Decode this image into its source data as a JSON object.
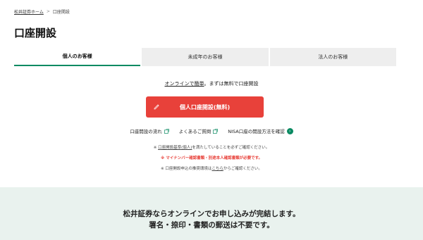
{
  "breadcrumb": {
    "home": "松井証券ホーム",
    "separator": ">",
    "current": "口座開設"
  },
  "page_title": "口座開設",
  "tabs": [
    {
      "label": "個人のお客様",
      "active": true
    },
    {
      "label": "未成年のお客様",
      "active": false
    },
    {
      "label": "法人のお客様",
      "active": false
    }
  ],
  "lead": {
    "part1": "オンラインで簡単",
    "part2": "。まずは無料で口座開設"
  },
  "cta": {
    "label": "個人口座開設(無料)",
    "icon": "pen-icon"
  },
  "links": [
    {
      "label": "口座開設の流れ",
      "icon": "external-link-icon"
    },
    {
      "label": "よくあるご質問",
      "icon": "external-link-icon"
    },
    {
      "label": "NISA口座の開設方法を確認",
      "icon": "arrow-right-circle-icon"
    }
  ],
  "notes": {
    "line1_prefix": "※ ",
    "line1_link": "口座開設基準(個人)",
    "line1_suffix": "を満たしていることを必ずご確認ください。",
    "line2": "※ マイナンバー確認書類・別途本人確認書類が必要です。",
    "line3_prefix": "※ 口座開設申込の推奨環境は",
    "line3_link": "こちら",
    "line3_suffix": "からご確認ください。"
  },
  "banner": {
    "line1": "松井証券ならオンラインでお申し込みが完結します。",
    "line2": "署名・捺印・書類の郵送は不要です。"
  },
  "colors": {
    "accent_green": "#0a8a62",
    "cta_red": "#e8413a",
    "band_bg": "#e9f2ee"
  }
}
